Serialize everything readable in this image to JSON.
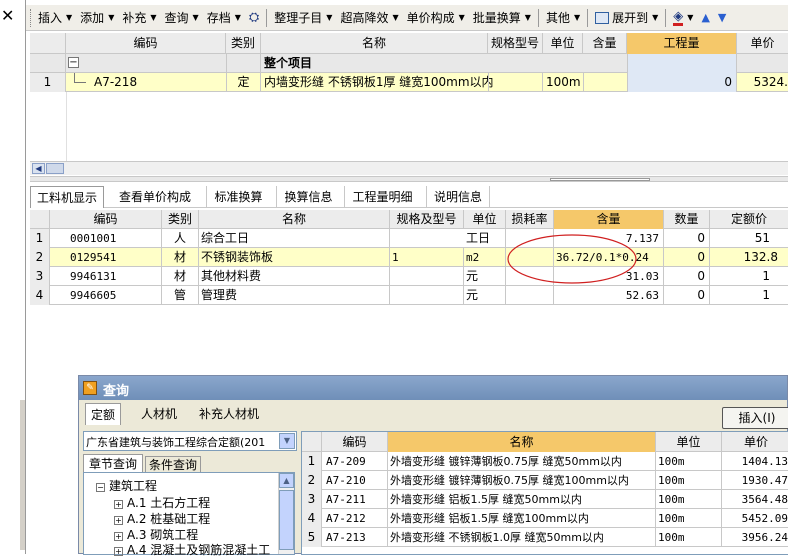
{
  "close_glyph": "✕",
  "toolbar": {
    "insert": "插入",
    "add": "添加",
    "supplement": "补充",
    "query": "查询",
    "storage": "存档",
    "organize": "整理子目",
    "height_reduce": "超高降效",
    "unit_price_comp": "单价构成",
    "batch_convert": "批量换算",
    "other": "其他",
    "expand_to": "展开到"
  },
  "top_table": {
    "headers": {
      "code": "编码",
      "category": "类别",
      "name": "名称",
      "spec": "规格型号",
      "unit": "单位",
      "content": "含量",
      "quantity": "工程量",
      "price": "单价"
    },
    "group_row": {
      "toggle": "−",
      "name": "整个项目"
    },
    "rows": [
      {
        "num": "1",
        "code": "A7-218",
        "category": "定",
        "name": "内墙变形缝 不锈钢板1厚 缝宽100mm以内",
        "unit": "100m",
        "quantity": "0",
        "price": "5324."
      }
    ]
  },
  "bottom_tabs": [
    "工料机显示",
    "查看单价构成",
    "标准换算",
    "换算信息",
    "工程量明细",
    "说明信息"
  ],
  "mat_table": {
    "headers": {
      "code": "编码",
      "category": "类别",
      "name": "名称",
      "spec": "规格及型号",
      "unit": "单位",
      "loss": "损耗率",
      "content": "含量",
      "qty": "数量",
      "price": "定额价"
    },
    "rows": [
      {
        "num": "1",
        "code": "0001001",
        "category": "人",
        "name": "综合工日",
        "spec": "",
        "unit": "工日",
        "content": "7.137",
        "qty": "0",
        "price": "51"
      },
      {
        "num": "2",
        "code": "0129541",
        "category": "材",
        "name": "不锈钢装饰板",
        "spec": "1",
        "unit": "m2",
        "content": "36.72/0.1*0.24",
        "qty": "0",
        "price": "132.8"
      },
      {
        "num": "3",
        "code": "9946131",
        "category": "材",
        "name": "其他材料费",
        "spec": "",
        "unit": "元",
        "content": "31.03",
        "qty": "0",
        "price": "1"
      },
      {
        "num": "4",
        "code": "9946605",
        "category": "管",
        "name": "管理费",
        "spec": "",
        "unit": "元",
        "content": "52.63",
        "qty": "0",
        "price": "1"
      }
    ]
  },
  "dialog": {
    "title": "查询",
    "tabs": [
      "定额",
      "人材机",
      "补充人材机"
    ],
    "insert_button": "插入(I)",
    "quota_select": "广东省建筑与装饰工程综合定额(201",
    "subtabs": [
      "章节查询",
      "条件查询"
    ],
    "tree": {
      "root": "建筑工程",
      "children": [
        "A.1 土石方工程",
        "A.2 桩基础工程",
        "A.3 砌筑工程",
        "A.4 混凝土及钢筋混凝土工"
      ]
    },
    "result_headers": {
      "code": "编码",
      "name": "名称",
      "unit": "单位",
      "price": "单价"
    },
    "results": [
      {
        "num": "1",
        "code": "A7-209",
        "name": "外墙变形缝 镀锌薄钢板0.75厚 缝宽50mm以内",
        "unit": "100m",
        "price": "1404.13"
      },
      {
        "num": "2",
        "code": "A7-210",
        "name": "外墙变形缝 镀锌薄钢板0.75厚 缝宽100mm以内",
        "unit": "100m",
        "price": "1930.47"
      },
      {
        "num": "3",
        "code": "A7-211",
        "name": "外墙变形缝 铝板1.5厚 缝宽50mm以内",
        "unit": "100m",
        "price": "3564.48"
      },
      {
        "num": "4",
        "code": "A7-212",
        "name": "外墙变形缝 铝板1.5厚 缝宽100mm以内",
        "unit": "100m",
        "price": "5452.09"
      },
      {
        "num": "5",
        "code": "A7-213",
        "name": "外墙变形缝 不锈钢板1.0厚 缝宽50mm以内",
        "unit": "100m",
        "price": "3956.24"
      }
    ]
  },
  "colors": {
    "highlight_header": "#f5c86a",
    "selected_row": "#ffffc8",
    "qty_col": "#dfe8f5",
    "annotation": "#d02020",
    "dialog_title": "#6f8fb8"
  }
}
